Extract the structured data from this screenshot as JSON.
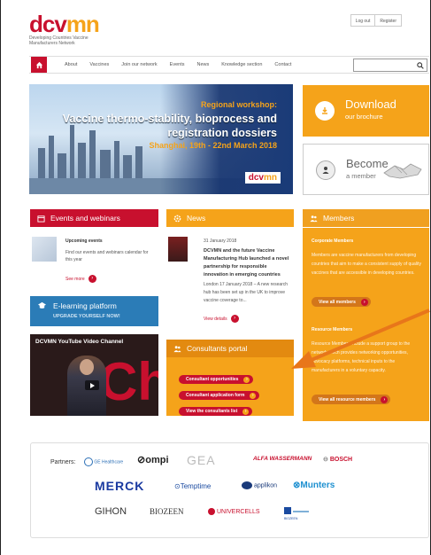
{
  "header": {
    "logo_text_a": "dcv",
    "logo_text_b": "mn",
    "logo_subtitle": "Developing Countries Vaccine Manufacturers Network",
    "login": "Log out",
    "register": "Register"
  },
  "nav": {
    "items": [
      "About",
      "Vaccines",
      "Join our network",
      "Events",
      "News",
      "Knowledge section",
      "Contact"
    ],
    "search_placeholder": ""
  },
  "hero": {
    "line1": "Regional workshop:",
    "line2": "Vaccine thermo-stability, bioprocess and registration dossiers",
    "line3": "Shanghai, 19th - 22nd March 2018",
    "logo_a": "dcv",
    "logo_b": "mn"
  },
  "download": {
    "title": "Download",
    "subtitle": "our brochure"
  },
  "become": {
    "title": "Become",
    "subtitle": "a member"
  },
  "events": {
    "heading": "Events and webinars",
    "item_title": "Upcoming events",
    "item_text": "Find our events and webinars calendar for this year",
    "see_more": "See more"
  },
  "elearning": {
    "title": "E-learning platform",
    "subtitle": "UPGRADE YOURSELF NOW!"
  },
  "youtube": {
    "title": "DCVMN YouTube Video Channel"
  },
  "news": {
    "heading": "News",
    "date": "31 January 2018",
    "title": "DCVMN and the future Vaccine Manufacturing Hub launched a novel partnership for responsible innovation in emerging countries",
    "text": "London 17 January 2018 – A new research hub has been set up in the UK to improve vaccine coverage to...",
    "view_details": "View details"
  },
  "consultants": {
    "heading": "Consultants portal",
    "buttons": [
      "Consultant opportunities",
      "Consultant application form",
      "View the consultants list"
    ]
  },
  "members": {
    "heading": "Members",
    "corporate_title": "Corporate Members",
    "corporate_text": "Members are vaccine manufacturers from developing countries that aim to make a consistent supply of quality vaccines that are accessible in developing countries.",
    "corporate_btn": "View all members",
    "resource_title": "Resource Members",
    "resource_text": "Resource Members include a support group to the network which provides networking opportunities, advocacy platforms, technical inputs to the manufacturers in a voluntary capacity.",
    "resource_btn": "View all resource members"
  },
  "partners": {
    "label": "Partners:",
    "logos": [
      "GE Healthcare",
      "ompi",
      "GEA",
      "ALFA WASSERMANN",
      "BOSCH",
      "MERCK",
      "Temptime",
      "applikon",
      "Munters",
      "GIHON",
      "BIOZEEN",
      "UNIVERCELLS",
      "BIOZEEN"
    ]
  },
  "colors": {
    "red": "#c8102e",
    "orange": "#f5a31a",
    "blue": "#2b7cb7"
  }
}
